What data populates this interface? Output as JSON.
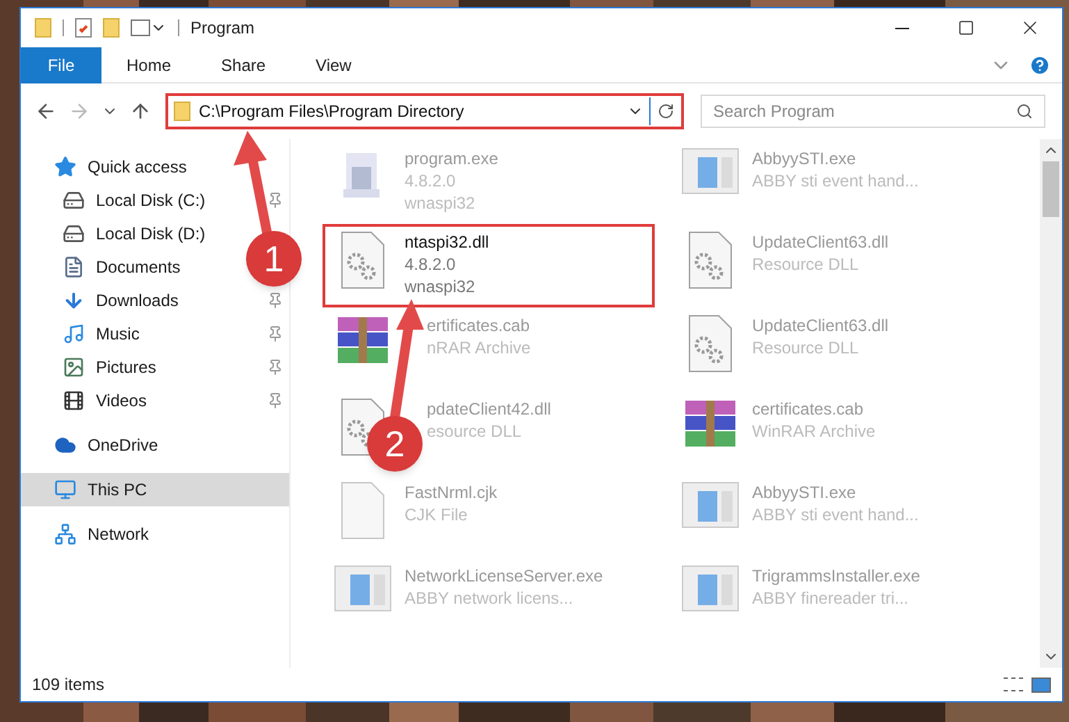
{
  "window": {
    "title": "Program"
  },
  "ribbon_tabs": [
    {
      "label": "File",
      "selected": true
    },
    {
      "label": "Home",
      "selected": false
    },
    {
      "label": "Share",
      "selected": false
    },
    {
      "label": "View",
      "selected": false
    }
  ],
  "address": {
    "path": "C:\\Program Files\\Program Directory",
    "highlighted": true
  },
  "search": {
    "placeholder": "Search Program"
  },
  "sidebar": {
    "items": [
      {
        "label": "Quick access",
        "kind": "quick",
        "selected": false,
        "children": [
          {
            "label": "Local Disk (C:)",
            "kind": "disk",
            "pinned": true
          },
          {
            "label": "Local Disk (D:)",
            "kind": "disk"
          },
          {
            "label": "Documents",
            "kind": "documents"
          },
          {
            "label": "Downloads",
            "kind": "downloads",
            "pinned": true
          },
          {
            "label": "Music",
            "kind": "music",
            "pinned": true
          },
          {
            "label": "Pictures",
            "kind": "pictures",
            "pinned": true
          },
          {
            "label": "Videos",
            "kind": "videos",
            "pinned": true
          }
        ]
      },
      {
        "label": "OneDrive",
        "kind": "cloud",
        "selected": false
      },
      {
        "label": "This PC",
        "kind": "pc",
        "selected": true
      },
      {
        "label": "Network",
        "kind": "network",
        "selected": false
      }
    ]
  },
  "files": [
    {
      "kind": "installer",
      "lines": [
        "program.exe",
        "4.8.2.0",
        "wnaspi32"
      ],
      "highlighted": false
    },
    {
      "kind": "app",
      "lines": [
        "AbbyySTI.exe",
        "ABBY sti event hand..."
      ],
      "highlighted": false
    },
    {
      "kind": "dll",
      "lines": [
        "ntaspi32.dll",
        "4.8.2.0",
        "wnaspi32"
      ],
      "highlighted": true
    },
    {
      "kind": "dll",
      "lines": [
        "UpdateClient63.dll",
        "Resource DLL"
      ],
      "highlighted": false
    },
    {
      "kind": "archive",
      "lines": [
        "ertificates.cab",
        "nRAR Archive"
      ],
      "highlighted": false,
      "covered": true
    },
    {
      "kind": "dll",
      "lines": [
        "UpdateClient63.dll",
        "Resource DLL"
      ],
      "highlighted": false
    },
    {
      "kind": "dll",
      "lines": [
        "pdateClient42.dll",
        "esource DLL"
      ],
      "highlighted": false,
      "covered": true
    },
    {
      "kind": "archive",
      "lines": [
        "certificates.cab",
        "WinRAR Archive"
      ],
      "highlighted": false
    },
    {
      "kind": "file",
      "lines": [
        "FastNrml.cjk",
        "CJK File"
      ],
      "highlighted": false
    },
    {
      "kind": "app",
      "lines": [
        "AbbyySTI.exe",
        "ABBY sti event hand..."
      ],
      "highlighted": false
    },
    {
      "kind": "app",
      "lines": [
        "NetworkLicenseServer.exe",
        "ABBY network licens..."
      ],
      "highlighted": false
    },
    {
      "kind": "app",
      "lines": [
        "TrigrammsInstaller.exe",
        "ABBY finereader tri..."
      ],
      "highlighted": false
    }
  ],
  "status_bar": {
    "item_count": "109 items"
  },
  "annotations": [
    {
      "label": "1"
    },
    {
      "label": "2"
    }
  ]
}
